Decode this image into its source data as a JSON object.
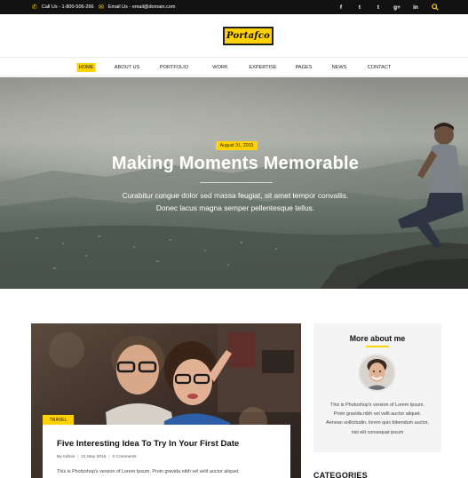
{
  "topbar": {
    "phone": "Call Us - 1-800-506-266",
    "email": "Email Us - email@domain.com",
    "social": [
      "f",
      "t",
      "t",
      "g+",
      "in"
    ]
  },
  "icons": {
    "phone": "phone-icon",
    "email": "envelope-icon",
    "social": [
      "facebook-icon",
      "twitter-icon",
      "tumblr-icon",
      "google-plus-icon",
      "linkedin-icon"
    ],
    "search": "search-icon"
  },
  "brand": {
    "logo": "Portafco",
    "accent": "#ffd200",
    "dark": "#121212"
  },
  "nav": {
    "items": [
      "HOME",
      "ABOUT US",
      "PORTFOLIO",
      "WORK",
      "EXPERTISE",
      "PAGES",
      "NEWS",
      "CONTACT"
    ],
    "active_index": 0
  },
  "hero": {
    "date": "August 31, 2015",
    "title": "Making Moments Memorable",
    "subtitle_line1": "Curabitur congue dolor sed massa feugiat, sit amet tempor convallis.",
    "subtitle_line2": "Donec lacus magna semper pellentesque tellus."
  },
  "post": {
    "tag": "TRAVEL",
    "title": "Five Interesting Idea To Try In Your First Date",
    "author": "By Admin",
    "date": "21 May 2016",
    "comments": "0 Comments",
    "excerpt": "This is Photoshop's version  of Lorem Ipsum. Proin gravida nibh vel velit auctor aliquet."
  },
  "sidebar": {
    "about_title": "More about me",
    "about_lines": [
      "This is Photoshop's version  of Lorem Ipsum.",
      "Proin gravida nibh vel velit auctor aliquet.",
      "Aenean sollicitudin, lorem quis bibendum auctor,",
      "nisi elit consequat ipsum"
    ],
    "categories_title": "CATEGORIES"
  }
}
